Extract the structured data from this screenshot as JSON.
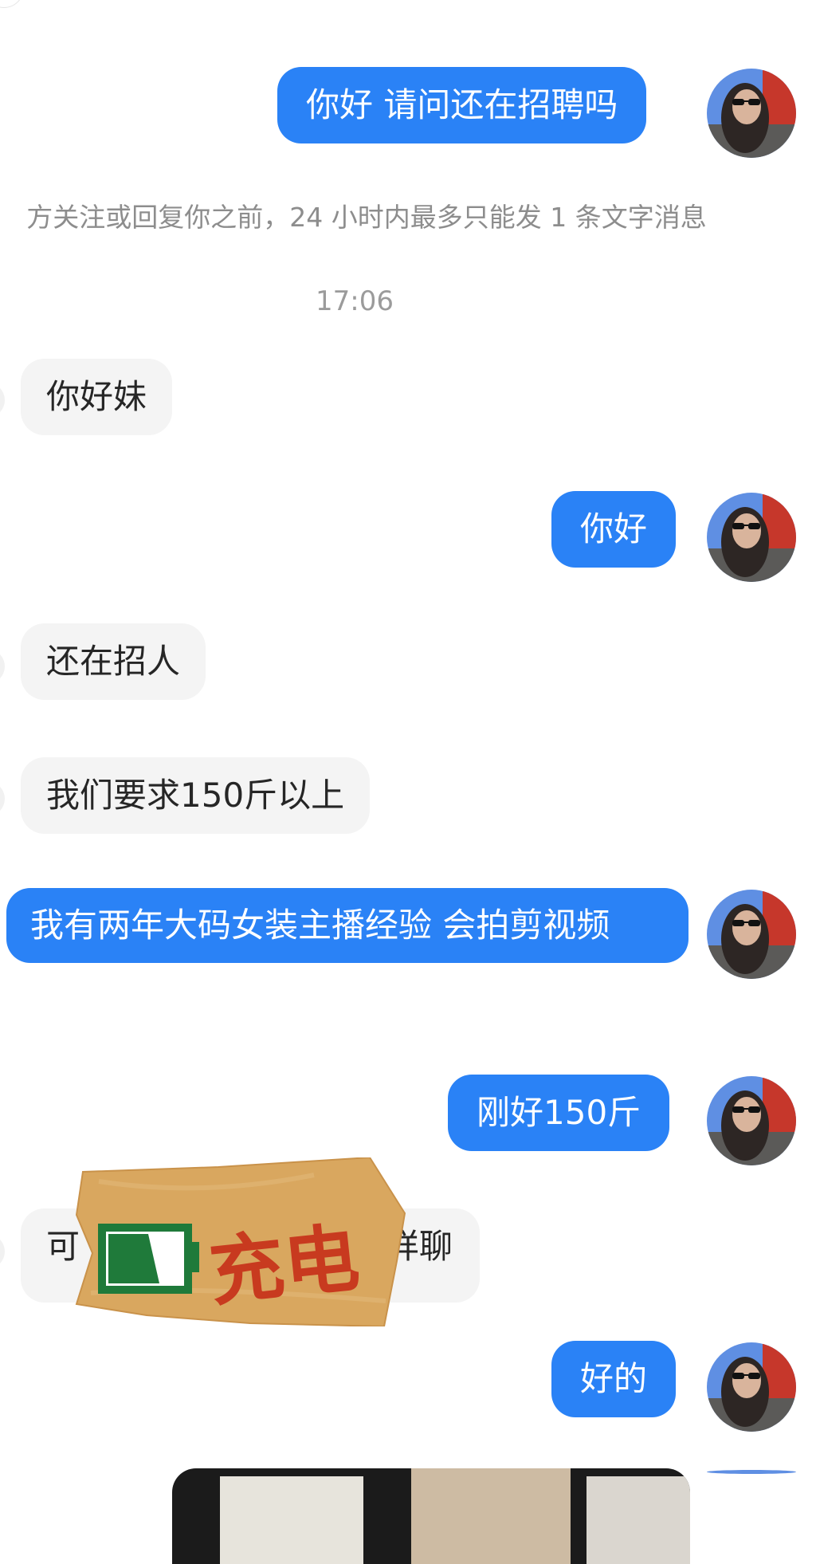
{
  "messages": [
    {
      "side": "out",
      "text": "你好 请问还在招聘吗"
    },
    {
      "side": "in",
      "text": "你好妹"
    },
    {
      "side": "out",
      "text": "你好"
    },
    {
      "side": "in",
      "text": "还在招人"
    },
    {
      "side": "in",
      "text": "我们要求150斤以上"
    },
    {
      "side": "out",
      "text": "我有两年大码女装主播经验 会拍剪视频"
    },
    {
      "side": "out",
      "text": "刚好150斤"
    },
    {
      "side": "in",
      "text_visible_start": "可",
      "text_visible_end": "详聊"
    },
    {
      "side": "out",
      "text": "好的"
    }
  ],
  "notice": "方关注或回复你之前，24 小时内最多只能发 1 条文字消息",
  "timestamp": "17:06",
  "sticker": {
    "label": "充电",
    "battery_color": "#1f7a3a",
    "paper_color": "#d9a75f",
    "text_color": "#c83a1f"
  },
  "colors": {
    "outgoing_bubble": "#2a82f6",
    "incoming_bubble": "#f4f4f4",
    "background": "#ffffff"
  },
  "icons": {
    "avatar": "user-avatar-photo",
    "sticker": "battery-charging-sticker"
  }
}
